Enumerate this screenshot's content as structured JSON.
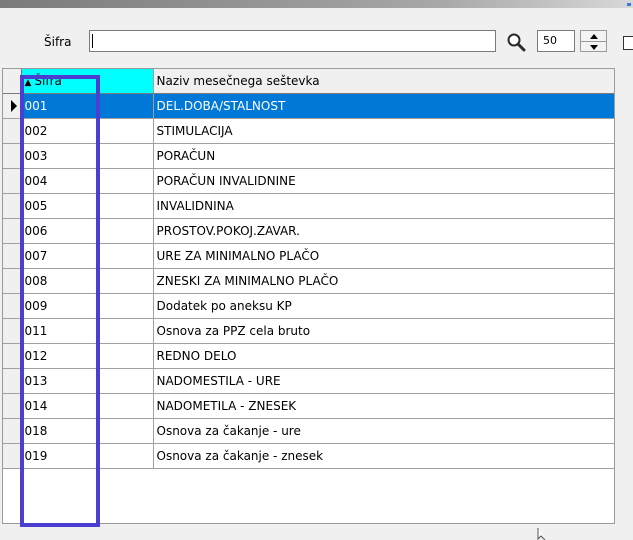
{
  "filter": {
    "label": "Šifra",
    "value": "",
    "page_size": "50"
  },
  "grid": {
    "columns": [
      {
        "label": "Šifra",
        "sorted": true
      },
      {
        "label": "Naziv mesečnega seštevka"
      }
    ],
    "selected_row": 0,
    "rows": [
      {
        "code": "001",
        "name": "DEL.DOBA/STALNOST"
      },
      {
        "code": "002",
        "name": "STIMULACIJA"
      },
      {
        "code": "003",
        "name": "PORAČUN"
      },
      {
        "code": "004",
        "name": "PORAČUN INVALIDNINE"
      },
      {
        "code": "005",
        "name": "INVALIDNINA"
      },
      {
        "code": "006",
        "name": "PROSTOV.POKOJ.ZAVAR."
      },
      {
        "code": "007",
        "name": "URE ZA MINIMALNO PLAČO"
      },
      {
        "code": "008",
        "name": "ZNESKI ZA MINIMALNO PLAČO"
      },
      {
        "code": "009",
        "name": "Dodatek po aneksu KP"
      },
      {
        "code": "011",
        "name": "Osnova za PPZ cela bruto"
      },
      {
        "code": "012",
        "name": "REDNO DELO"
      },
      {
        "code": "013",
        "name": "NADOMESTILA - URE"
      },
      {
        "code": "014",
        "name": "NADOMETILA - ZNESEK"
      },
      {
        "code": "018",
        "name": "Osnova za čakanje - ure"
      },
      {
        "code": "019",
        "name": "Osnova za čakanje - znesek"
      }
    ]
  },
  "colors": {
    "selection": "#0078d7",
    "sorted_header": "#00ffff",
    "annotation_box": "#4a3fd0"
  },
  "icons": [
    "search-icon",
    "spinner-up-icon",
    "spinner-down-icon",
    "row-indicator-icon",
    "mouse-cursor-icon"
  ]
}
